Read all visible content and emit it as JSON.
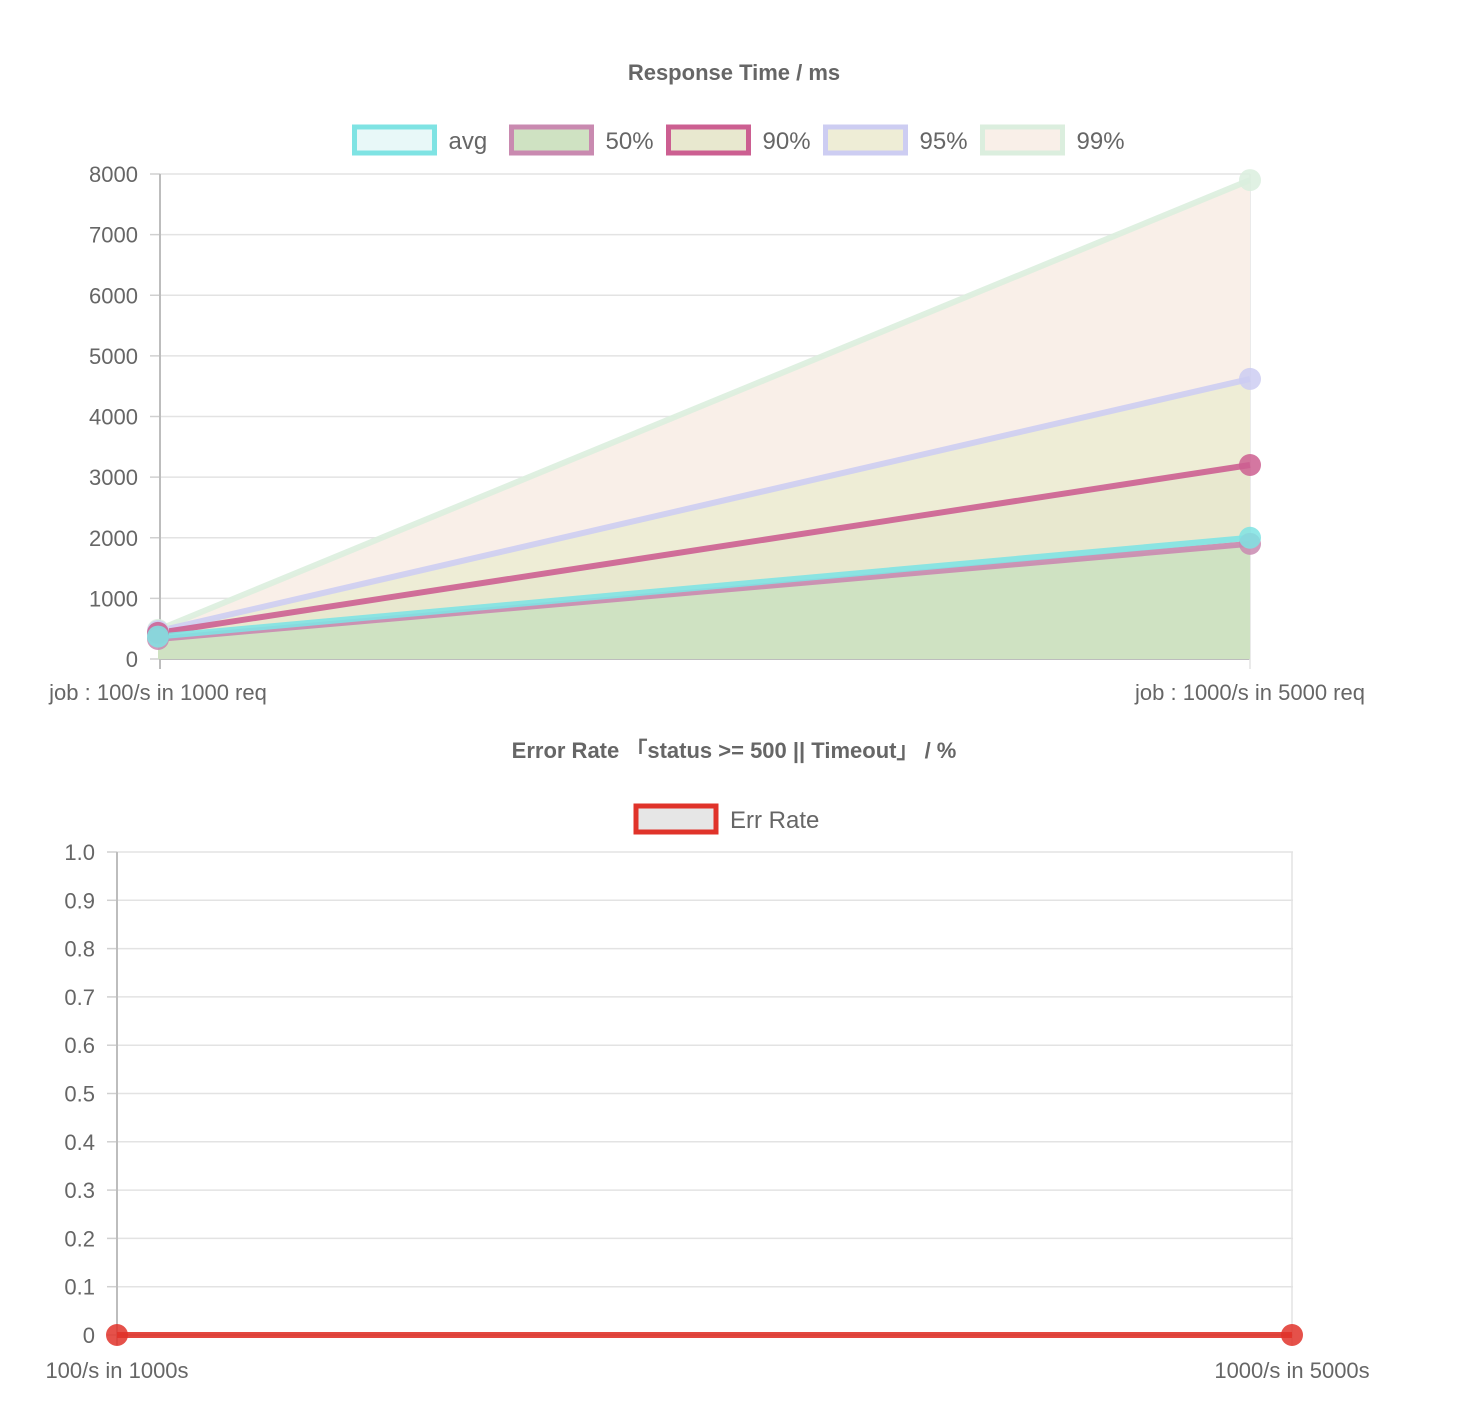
{
  "chart_data": [
    {
      "type": "area",
      "title": "Response Time / ms",
      "categories": [
        "job : 100/s in 1000 req",
        "job : 1000/s in 5000 req"
      ],
      "ylim": [
        0,
        8000
      ],
      "yticks": [
        0,
        1000,
        2000,
        3000,
        4000,
        5000,
        6000,
        7000,
        8000
      ],
      "grid": true,
      "legend": "top",
      "series": [
        {
          "name": "avg",
          "values": [
            370,
            2000
          ],
          "color": "#7fe3e3",
          "fill": "rgba(200,238,238,0.35)",
          "fillArea": false
        },
        {
          "name": "50%",
          "values": [
            330,
            1900
          ],
          "color": "#c98ab0",
          "fill": "#cfe2c2",
          "fillArea": true
        },
        {
          "name": "90%",
          "values": [
            430,
            3200
          ],
          "color": "#cc5f91",
          "fill": "#e8e8cf",
          "fillArea": true
        },
        {
          "name": "95%",
          "values": [
            460,
            4620
          ],
          "color": "#cdcdf2",
          "fill": "#eeedd6",
          "fillArea": true
        },
        {
          "name": "99%",
          "values": [
            480,
            7900
          ],
          "color": "#dbeede",
          "fill": "#f9efe8",
          "fillArea": true
        }
      ]
    },
    {
      "type": "line",
      "title": "Error Rate 「status >= 500 || Timeout」 / %",
      "categories": [
        "100/s in 1000s",
        "1000/s in 5000s"
      ],
      "ylim": [
        0,
        1.0
      ],
      "yticks": [
        "0",
        "0.1",
        "0.2",
        "0.3",
        "0.4",
        "0.5",
        "0.6",
        "0.7",
        "0.8",
        "0.9",
        "1.0"
      ],
      "grid": true,
      "legend": "top",
      "series": [
        {
          "name": "Err Rate",
          "values": [
            0,
            0
          ],
          "color": "#e0332a",
          "fill": "#e6e6e6"
        }
      ]
    }
  ]
}
